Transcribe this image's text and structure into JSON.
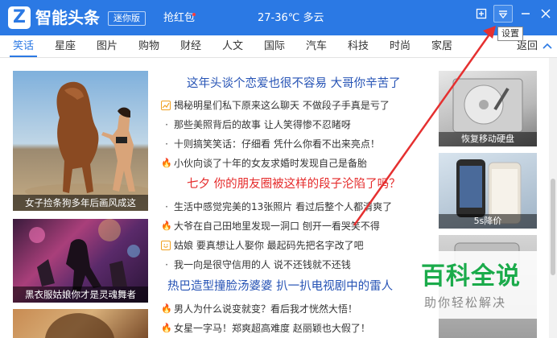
{
  "titlebar": {
    "logo_char": "Z",
    "app_name": "智能头条",
    "mini_badge": "迷你版",
    "hongbao": "抢红包",
    "weather": "27-36℃ 多云",
    "settings_tooltip": "设置"
  },
  "nav": {
    "tabs": [
      "笑话",
      "星座",
      "图片",
      "购物",
      "财经",
      "人文",
      "国际",
      "汽车",
      "科技",
      "时尚",
      "家居"
    ],
    "active_tab": "笑话",
    "back_label": "返回"
  },
  "left_images": [
    {
      "caption": "女子捡条狗多年后画风成这"
    },
    {
      "caption": "黑衣服姑娘你才是灵魂舞者"
    },
    {
      "caption": ""
    }
  ],
  "main": {
    "headlines": [
      "这年头谈个恋爱也很不容易 大哥你辛苦了",
      "七夕 你的朋友圈被这样的段子沦陷了吗？",
      "热巴造型撞脸汤婆婆 扒一扒电视剧中的雷人"
    ],
    "news": [
      {
        "icon": "chart-icon",
        "text": "揭秘明星们私下原来这么聊天 不做段子手真是亏了"
      },
      {
        "icon": "dot-icon",
        "text": "那些美照背后的故事 让人笑得惨不忍睹呀"
      },
      {
        "icon": "dot-icon",
        "text": "十则搞笑笑话：仔细看 凭什么你看不出来亮点！"
      },
      {
        "icon": "fire-icon",
        "text": "小伙向谈了十年的女友求婚时发现自己是备胎"
      },
      {
        "icon": "dot-icon",
        "text": "生活中感觉完美的13张照片 看过后整个人都清爽了"
      },
      {
        "icon": "fire-icon",
        "text": "大爷在自己田地里发现一洞口 刨开一看哭笑不得"
      },
      {
        "icon": "smile-icon",
        "text": "姑娘 要真想让人娶你 最起码先把名字改了吧"
      },
      {
        "icon": "dot-icon",
        "text": "我一向是很守信用的人 说不还钱就不还钱"
      },
      {
        "icon": "fire-icon",
        "text": "男人为什么说变就变？看后我才恍然大悟！"
      },
      {
        "icon": "fire-icon",
        "text": "女星一字马！郑爽超高难度 赵丽颖也大假了！"
      }
    ]
  },
  "right_images": [
    {
      "caption": "恢复移动硬盘"
    },
    {
      "caption": "5s降价"
    },
    {
      "caption": ""
    }
  ],
  "watermark": {
    "title": "百科全说",
    "subtitle": "助你轻松解决"
  },
  "colors": {
    "brand_blue": "#2b79e4",
    "headline_blue": "#2653b5",
    "headline_red": "#e52b2b",
    "annotation_red": "#e53030"
  }
}
